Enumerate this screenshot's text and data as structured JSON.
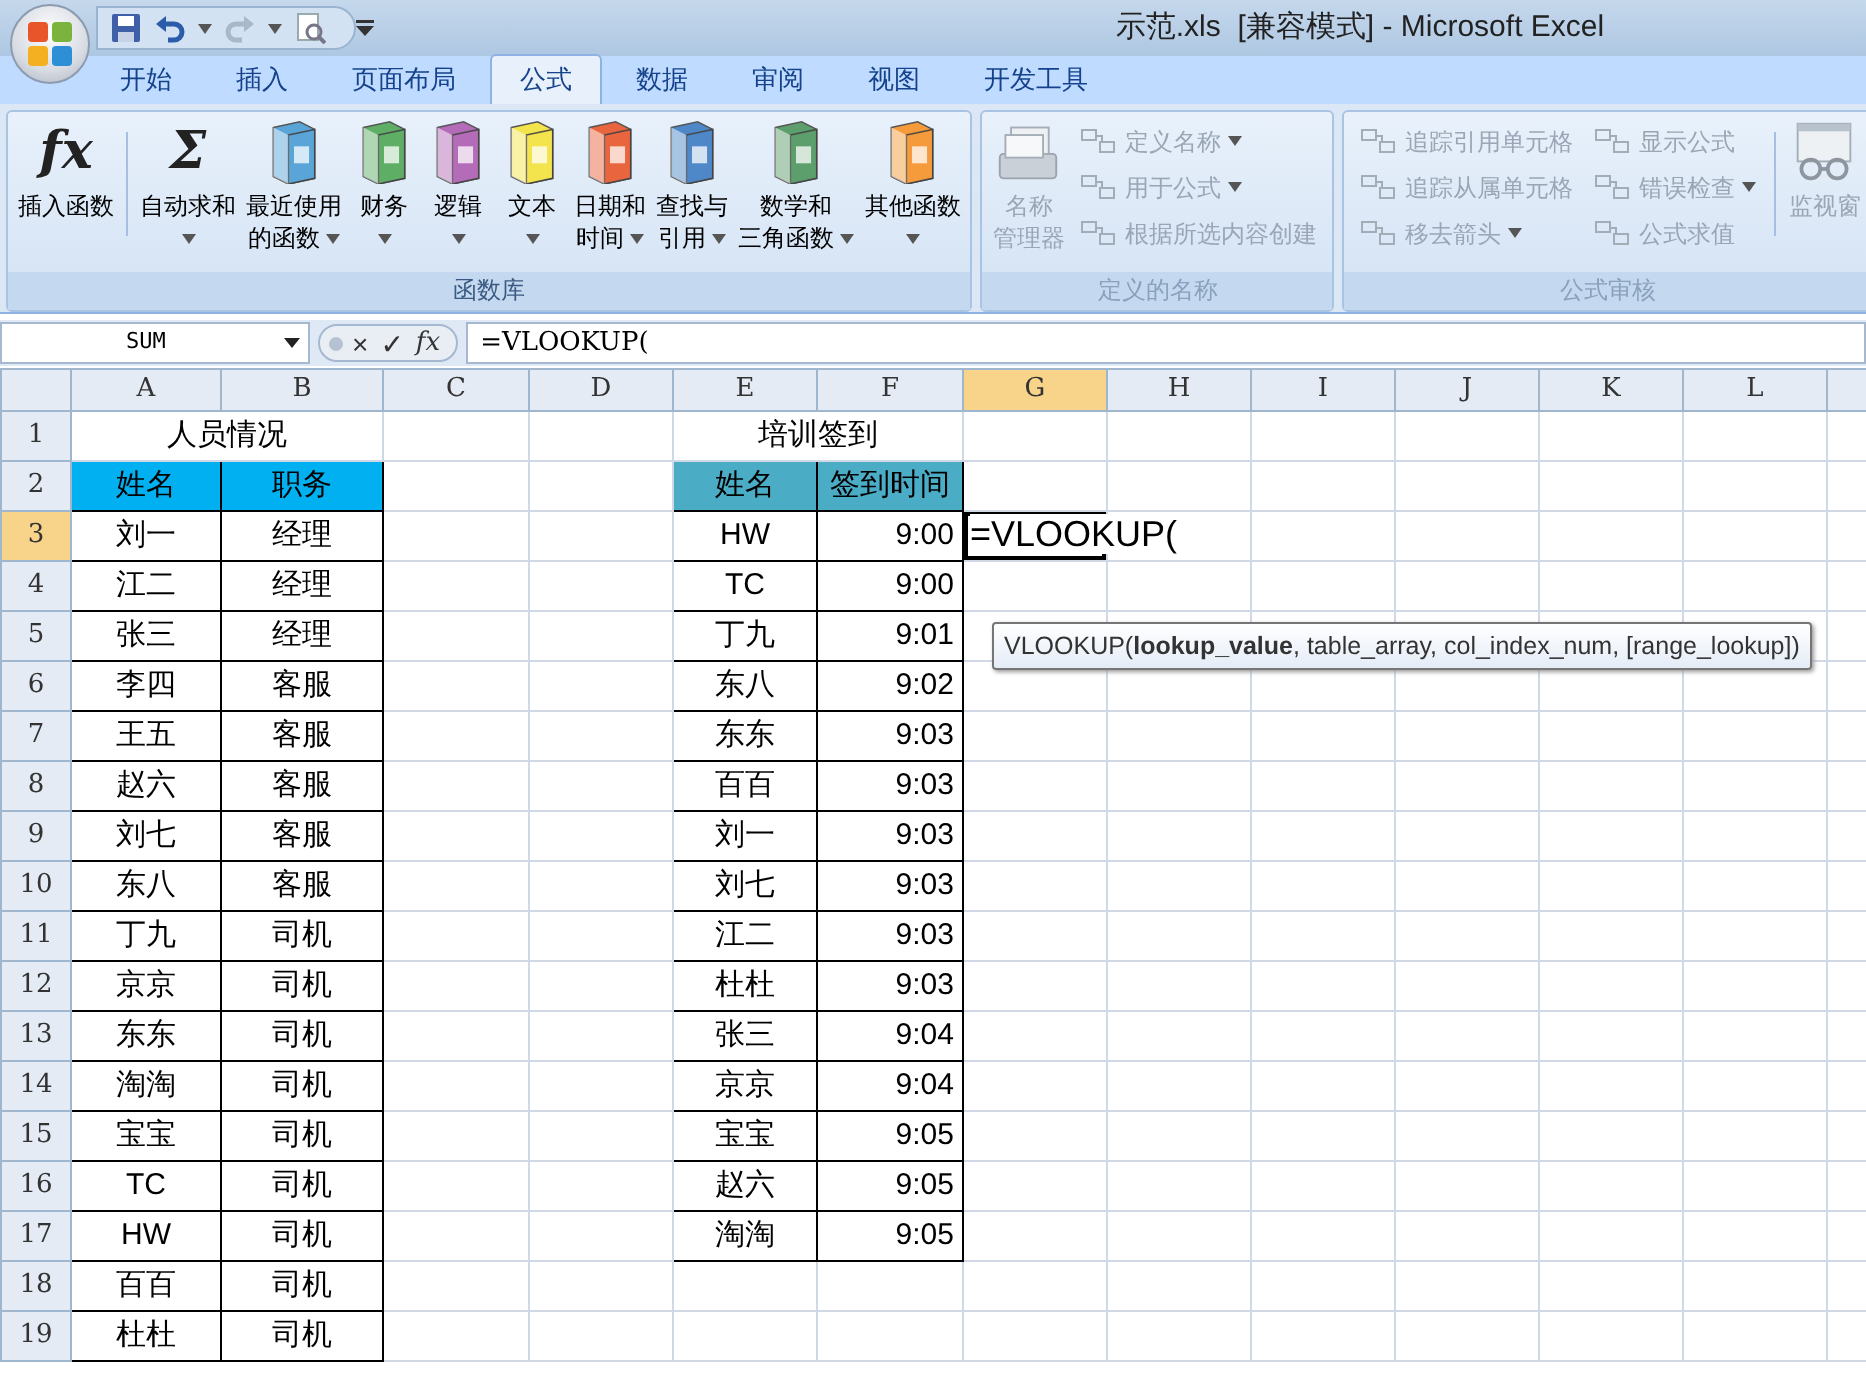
{
  "window": {
    "title": "示范.xls  [兼容模式] - Microsoft Excel"
  },
  "tabs": [
    {
      "label": "开始",
      "selected": false
    },
    {
      "label": "插入",
      "selected": false
    },
    {
      "label": "页面布局",
      "selected": false
    },
    {
      "label": "公式",
      "selected": true
    },
    {
      "label": "数据",
      "selected": false
    },
    {
      "label": "审阅",
      "selected": false
    },
    {
      "label": "视图",
      "selected": false
    },
    {
      "label": "开发工具",
      "selected": false
    }
  ],
  "ribbon": {
    "groups": [
      {
        "title": "函数库",
        "disabled": false,
        "items": [
          {
            "kind": "glyph",
            "glyph": "fx",
            "lines": [
              "插入函数"
            ],
            "dropdown": false,
            "divider_after": true
          },
          {
            "kind": "glyph",
            "glyph": "Σ",
            "lines": [
              "自动求和"
            ],
            "dropdown": true
          },
          {
            "kind": "book",
            "color": "#5aa5d8",
            "lines": [
              "最近使用",
              "的函数"
            ],
            "dropdown": true
          },
          {
            "kind": "book",
            "color": "#5fae66",
            "lines": [
              "财务"
            ],
            "dropdown": true
          },
          {
            "kind": "book",
            "color": "#b46bb8",
            "lines": [
              "逻辑"
            ],
            "dropdown": true
          },
          {
            "kind": "book",
            "color": "#f3e34c",
            "lines": [
              "文本"
            ],
            "dropdown": true
          },
          {
            "kind": "book",
            "color": "#e8653e",
            "lines": [
              "日期和",
              "时间"
            ],
            "dropdown": true
          },
          {
            "kind": "book",
            "color": "#4f88c8",
            "lines": [
              "查找与",
              "引用"
            ],
            "dropdown": true
          },
          {
            "kind": "book",
            "color": "#5c9f6c",
            "lines": [
              "数学和",
              "三角函数"
            ],
            "dropdown": true
          },
          {
            "kind": "book",
            "color": "#f59b3b",
            "lines": [
              "其他函数"
            ],
            "dropdown": true
          }
        ]
      },
      {
        "title": "定义的名称",
        "disabled": true,
        "items": [
          {
            "kind": "cardfile",
            "lines": [
              "名称",
              "管理器"
            ],
            "dropdown": false
          },
          {
            "kind": "stack",
            "items": [
              {
                "label": "定义名称",
                "dropdown": true
              },
              {
                "label": "用于公式",
                "dropdown": true
              },
              {
                "label": "根据所选内容创建",
                "dropdown": false
              }
            ]
          }
        ]
      },
      {
        "title": "公式审核",
        "disabled": true,
        "items": [
          {
            "kind": "stack",
            "items": [
              {
                "label": "追踪引用单元格",
                "dropdown": false
              },
              {
                "label": "追踪从属单元格",
                "dropdown": false
              },
              {
                "label": "移去箭头",
                "dropdown": true
              }
            ]
          },
          {
            "kind": "stack",
            "items": [
              {
                "label": "显示公式",
                "dropdown": false
              },
              {
                "label": "错误检查",
                "dropdown": true
              },
              {
                "label": "公式求值",
                "dropdown": false
              }
            ],
            "divider_after": true
          },
          {
            "kind": "glasses",
            "lines": [
              "监视窗"
            ],
            "dropdown": false
          }
        ]
      }
    ]
  },
  "formula_bar": {
    "name_box": "SUM",
    "buttons": [
      "×",
      "✓",
      "fx"
    ],
    "formula": "=VLOOKUP("
  },
  "sheet": {
    "columns": [
      {
        "label": "A",
        "selected": false
      },
      {
        "label": "B",
        "selected": false
      },
      {
        "label": "C",
        "selected": false
      },
      {
        "label": "D",
        "selected": false
      },
      {
        "label": "E",
        "selected": false
      },
      {
        "label": "F",
        "selected": false
      },
      {
        "label": "G",
        "selected": true
      },
      {
        "label": "H",
        "selected": false
      },
      {
        "label": "I",
        "selected": false
      },
      {
        "label": "J",
        "selected": false
      },
      {
        "label": "K",
        "selected": false
      },
      {
        "label": "L",
        "selected": false
      }
    ],
    "rows": [
      {
        "number": "1",
        "selected": false
      },
      {
        "number": "2",
        "selected": false
      },
      {
        "number": "3",
        "selected": true
      },
      {
        "number": "4",
        "selected": false
      },
      {
        "number": "5",
        "selected": false
      },
      {
        "number": "6",
        "selected": false
      },
      {
        "number": "7",
        "selected": false
      },
      {
        "number": "8",
        "selected": false
      },
      {
        "number": "9",
        "selected": false
      },
      {
        "number": "10",
        "selected": false
      },
      {
        "number": "11",
        "selected": false
      },
      {
        "number": "12",
        "selected": false
      },
      {
        "number": "13",
        "selected": false
      },
      {
        "number": "14",
        "selected": false
      },
      {
        "number": "15",
        "selected": false
      },
      {
        "number": "16",
        "selected": false
      },
      {
        "number": "17",
        "selected": false
      },
      {
        "number": "18",
        "selected": false
      },
      {
        "number": "19",
        "selected": false
      }
    ],
    "staff_table": {
      "title": "人员情况",
      "headers": [
        "姓名",
        "职务"
      ],
      "rows": [
        [
          "刘一",
          "经理"
        ],
        [
          "江二",
          "经理"
        ],
        [
          "张三",
          "经理"
        ],
        [
          "李四",
          "客服"
        ],
        [
          "王五",
          "客服"
        ],
        [
          "赵六",
          "客服"
        ],
        [
          "刘七",
          "客服"
        ],
        [
          "东八",
          "客服"
        ],
        [
          "丁九",
          "司机"
        ],
        [
          "京京",
          "司机"
        ],
        [
          "东东",
          "司机"
        ],
        [
          "淘淘",
          "司机"
        ],
        [
          "宝宝",
          "司机"
        ],
        [
          "TC",
          "司机"
        ],
        [
          "HW",
          "司机"
        ],
        [
          "百百",
          "司机"
        ],
        [
          "杜杜",
          "司机"
        ]
      ]
    },
    "sign_in_table": {
      "title": "培训签到",
      "headers": [
        "姓名",
        "签到时间"
      ],
      "rows": [
        [
          "HW",
          "9:00"
        ],
        [
          "TC",
          "9:00"
        ],
        [
          "丁九",
          "9:01"
        ],
        [
          "东八",
          "9:02"
        ],
        [
          "东东",
          "9:03"
        ],
        [
          "百百",
          "9:03"
        ],
        [
          "刘一",
          "9:03"
        ],
        [
          "刘七",
          "9:03"
        ],
        [
          "江二",
          "9:03"
        ],
        [
          "杜杜",
          "9:03"
        ],
        [
          "张三",
          "9:04"
        ],
        [
          "京京",
          "9:04"
        ],
        [
          "宝宝",
          "9:05"
        ],
        [
          "赵六",
          "9:05"
        ],
        [
          "淘淘",
          "9:05"
        ]
      ]
    },
    "active_cell": {
      "text": "=VLOOKUP(",
      "tooltip": "VLOOKUP(**lookup_value**, table_array, col_index_num, [range_lookup])"
    }
  }
}
